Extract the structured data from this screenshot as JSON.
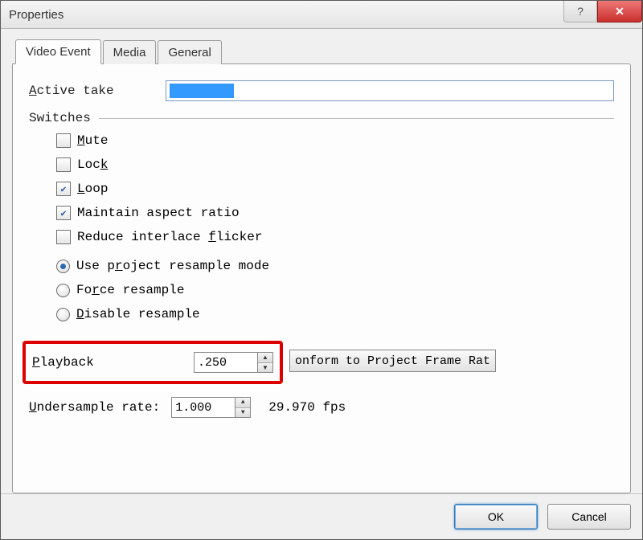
{
  "window": {
    "title": "Properties"
  },
  "tabs": {
    "video": "Video Event",
    "media": "Media",
    "general": "General"
  },
  "active_take": {
    "label_pre": "A",
    "label_post": "ctive take"
  },
  "switches": {
    "title": "Switches",
    "mute": {
      "label_pre": "M",
      "label_post": "ute",
      "checked": false
    },
    "lock": {
      "label_pre": "L",
      "label_post": "oc",
      "label_post2": "k",
      "checked": false
    },
    "loop": {
      "label_pre": "L",
      "label_post": "oop",
      "checked": true
    },
    "aspect": {
      "label": "Maintain aspect ratio",
      "checked": true
    },
    "flicker": {
      "label_pre": "Reduce interlace ",
      "label_ul": "f",
      "label_post": "licker",
      "checked": false
    }
  },
  "resample": {
    "project": {
      "label_pre": "Use p",
      "label_ul": "r",
      "label_post": "oject resample mode",
      "selected": true
    },
    "force": {
      "label_pre": "Fo",
      "label_ul": "r",
      "label_post": "ce resample",
      "selected": false
    },
    "disable": {
      "label_ul": "D",
      "label_post": "isable resample",
      "selected": false
    }
  },
  "playback": {
    "label_ul": "P",
    "label_post": "layback",
    "value": ".250"
  },
  "conform": {
    "label": "onform to Project Frame Rat"
  },
  "undersample": {
    "label_ul": "U",
    "label_post": "ndersample rate:",
    "value": "1.000",
    "fps": "29.970 fps"
  },
  "footer": {
    "ok": "OK",
    "cancel": "Cancel"
  }
}
